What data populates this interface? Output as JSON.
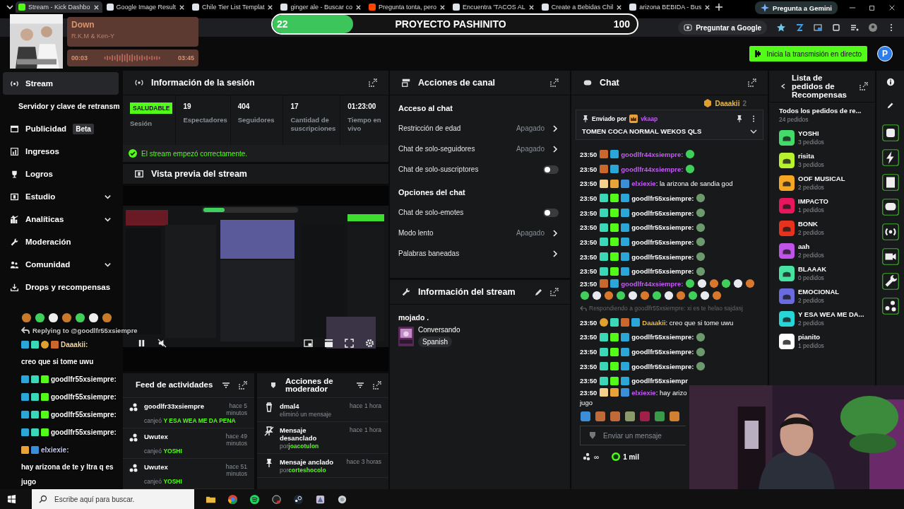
{
  "browser": {
    "tabs": [
      {
        "label": "Stream - Kick Dashbo",
        "selected": true
      },
      {
        "label": "Google Image Result",
        "selected": false
      },
      {
        "label": "Chile Tier List Templat",
        "selected": false
      },
      {
        "label": "ginger ale - Buscar co",
        "selected": false
      },
      {
        "label": "Pregunta tonta, pero",
        "selected": false
      },
      {
        "label": "Encuentra 'TACOS AL",
        "selected": false
      },
      {
        "label": "Create a Bebidas Chil",
        "selected": false
      },
      {
        "label": "arizona BEBIDA - Bus",
        "selected": false
      }
    ],
    "gemini_button": "Pregunta a Gemini",
    "ask_google": "Preguntar a Google"
  },
  "topbar": {
    "go_live": "Inicia la transmisión en directo",
    "avatar": "P"
  },
  "sidebar": {
    "items": [
      {
        "label": "Stream",
        "selected": true,
        "has_submenu": false,
        "children": [
          {
            "label": "Servidor y clave de retransm",
            "selected": false
          }
        ]
      },
      {
        "label": "Publicidad",
        "badge": "Beta",
        "selected": false,
        "has_submenu": false
      },
      {
        "label": "Ingresos",
        "selected": false,
        "has_submenu": false
      },
      {
        "label": "Logros",
        "selected": false,
        "has_submenu": false
      },
      {
        "label": "Estudio",
        "selected": false,
        "has_submenu": true
      },
      {
        "label": "Analíticas",
        "selected": false,
        "has_submenu": true
      },
      {
        "label": "Moderación",
        "selected": false,
        "has_submenu": false
      },
      {
        "label": "Comunidad",
        "selected": false,
        "has_submenu": true
      },
      {
        "label": "Drops y recompensas",
        "selected": false,
        "has_submenu": false
      }
    ]
  },
  "session": {
    "title": "Información de la sesión",
    "status": "SALUDABLE",
    "status_label": "Sesión",
    "stats": [
      {
        "value": "19",
        "label": "Espectadores"
      },
      {
        "value": "404",
        "label": "Seguidores"
      },
      {
        "value": "17",
        "label": "Cantidad de suscripciones"
      },
      {
        "value": "01:23:00",
        "label": "Tiempo en vivo"
      }
    ],
    "message": "El stream empezó correctamente."
  },
  "preview": {
    "title": "Vista previa del stream"
  },
  "activity_feed": {
    "title": "Feed de actividades",
    "items": [
      {
        "user": "goodlfr33xsiempre",
        "action": "canjeó",
        "reward": "Y ESA WEA ME DA PENA",
        "time": "hace 5 minutos"
      },
      {
        "user": "Uwutex",
        "action": "canjeó",
        "reward": "YOSHI",
        "time": "hace 49 minutos"
      },
      {
        "user": "Uwutex",
        "action": "canjeó",
        "reward": "YOSHI",
        "time": "hace 51 minutos"
      }
    ]
  },
  "mod_actions": {
    "title": "Acciones de moderador",
    "items": [
      {
        "kind": "delete",
        "title": "dmal4",
        "detail": "eliminó un mensaje",
        "time": "hace 1 hora"
      },
      {
        "kind": "unpin",
        "title": "Mensaje desanclado",
        "detail_prefix": "por",
        "user": "joacotulon",
        "time": "hace 1 hora"
      },
      {
        "kind": "pin",
        "title": "Mensaje anclado",
        "detail_prefix": "por",
        "user": "corteshocolo",
        "time": "hace 3 horas"
      }
    ]
  },
  "channel_actions": {
    "title": "Acciones de canal",
    "sections": [
      {
        "title": "Acceso al chat",
        "rows": [
          {
            "kind": "link",
            "label": "Restricción de edad",
            "value": "Apagado"
          },
          {
            "kind": "link",
            "label": "Chat de solo-seguidores",
            "value": "Apagado"
          },
          {
            "kind": "toggle",
            "label": "Chat de solo-suscriptores",
            "on": false
          }
        ]
      },
      {
        "title": "Opciones del chat",
        "rows": [
          {
            "kind": "toggle",
            "label": "Chat de solo-emotes",
            "on": false
          },
          {
            "kind": "link",
            "label": "Modo lento",
            "value": "Apagado"
          },
          {
            "kind": "link",
            "label": "Palabras baneadas"
          }
        ]
      }
    ]
  },
  "stream_info": {
    "title": "Información del stream",
    "stream_title": "mojado .",
    "category": "Conversando",
    "tag": "Spanish"
  },
  "chat": {
    "title": "Chat",
    "leader": {
      "name": "Daaakii",
      "count": "2"
    },
    "pinned": {
      "label": "Enviado por",
      "user": "vkaap",
      "text": "TOMEN COCA NORMAL WEKOS QLS"
    },
    "messages": [
      {
        "kind": "message",
        "time": "23:50",
        "badges": [
          {
            "kind": "p"
          },
          {
            "kind": "mod"
          }
        ],
        "user": "goodlfr44xsiempre:",
        "color": "#c15cf2",
        "emotes": [
          {
            "kind": "frog"
          }
        ]
      },
      {
        "kind": "message",
        "time": "23:50",
        "badges": [
          {
            "kind": "p"
          },
          {
            "kind": "mod"
          }
        ],
        "user": "goodlfr44xsiempre:",
        "color": "#c15cf2",
        "emotes": [
          {
            "kind": "frog"
          }
        ]
      },
      {
        "kind": "message",
        "time": "23:50",
        "badges": [
          {
            "kind": "age"
          },
          {
            "kind": "crown"
          },
          {
            "kind": "pblue"
          }
        ],
        "user": "elxiexie",
        "color": "#c15cf2",
        "text": ": la arizona de sandia god"
      },
      {
        "kind": "message",
        "time": "23:50",
        "badges": [
          {
            "kind": "sub"
          },
          {
            "kind": "gift"
          },
          {
            "kind": "mod"
          }
        ],
        "user": "goodlfr55xsiempre:",
        "color": "#ffffff",
        "emotes": [
          {
            "kind": "pepe"
          }
        ]
      },
      {
        "kind": "message",
        "time": "23:50",
        "badges": [
          {
            "kind": "sub"
          },
          {
            "kind": "gift"
          },
          {
            "kind": "mod"
          }
        ],
        "user": "goodlfr55xsiempre:",
        "color": "#ffffff",
        "emotes": [
          {
            "kind": "pepe"
          }
        ]
      },
      {
        "kind": "message",
        "time": "23:50",
        "badges": [
          {
            "kind": "sub"
          },
          {
            "kind": "gift"
          },
          {
            "kind": "mod"
          }
        ],
        "user": "goodlfr55xsiempre:",
        "color": "#ffffff",
        "emotes": [
          {
            "kind": "pepe"
          }
        ]
      },
      {
        "kind": "message",
        "time": "23:50",
        "badges": [
          {
            "kind": "sub"
          },
          {
            "kind": "gift"
          },
          {
            "kind": "mod"
          }
        ],
        "user": "goodlfr55xsiempre:",
        "color": "#ffffff",
        "emotes": [
          {
            "kind": "pepe"
          }
        ]
      },
      {
        "kind": "message",
        "time": "23:50",
        "badges": [
          {
            "kind": "sub"
          },
          {
            "kind": "gift"
          },
          {
            "kind": "mod"
          }
        ],
        "user": "goodlfr55xsiempre:",
        "color": "#ffffff",
        "emotes": [
          {
            "kind": "pepe"
          }
        ]
      },
      {
        "kind": "message",
        "time": "23:50",
        "badges": [
          {
            "kind": "sub"
          },
          {
            "kind": "gift"
          },
          {
            "kind": "mod"
          }
        ],
        "user": "goodlfr55xsiempre:",
        "color": "#ffffff",
        "emotes": [
          {
            "kind": "pepe"
          }
        ]
      },
      {
        "kind": "message",
        "time": "23:50",
        "badges": [
          {
            "kind": "p"
          },
          {
            "kind": "mod"
          }
        ],
        "user": "goodlfr44xsiempre:",
        "color": "#c15cf2",
        "emotes": [
          {
            "kind": "frog"
          },
          {
            "kind": "cup"
          },
          {
            "kind": "cat"
          },
          {
            "kind": "frog"
          },
          {
            "kind": "cup"
          },
          {
            "kind": "cat"
          },
          {
            "kind": "frog"
          },
          {
            "kind": "cup"
          },
          {
            "kind": "cat"
          },
          {
            "kind": "frog"
          },
          {
            "kind": "cup"
          },
          {
            "kind": "cat"
          },
          {
            "kind": "frog"
          },
          {
            "kind": "cup"
          },
          {
            "kind": "cat"
          },
          {
            "kind": "frog"
          },
          {
            "kind": "cup"
          },
          {
            "kind": "cat"
          }
        ]
      },
      {
        "kind": "reply",
        "text": "Respondiendo a goodlfr55xsiempre: xi es te helao sajdasj"
      },
      {
        "kind": "message",
        "time": "23:50",
        "badges": [
          {
            "kind": "coin"
          },
          {
            "kind": "sub"
          },
          {
            "kind": "p"
          },
          {
            "kind": "mod"
          }
        ],
        "user": "Daaakii",
        "color": "#e8b94a",
        "text": ": creo que si tome uwu"
      },
      {
        "kind": "message",
        "time": "23:50",
        "badges": [
          {
            "kind": "sub"
          },
          {
            "kind": "gift"
          },
          {
            "kind": "mod"
          }
        ],
        "user": "goodlfr55xsiempre:",
        "color": "#ffffff",
        "emotes": [
          {
            "kind": "pepe"
          }
        ]
      },
      {
        "kind": "message",
        "time": "23:50",
        "badges": [
          {
            "kind": "sub"
          },
          {
            "kind": "gift"
          },
          {
            "kind": "mod"
          }
        ],
        "user": "goodlfr55xsiempre:",
        "color": "#ffffff",
        "emotes": [
          {
            "kind": "pepe"
          }
        ]
      },
      {
        "kind": "message",
        "time": "23:50",
        "badges": [
          {
            "kind": "sub"
          },
          {
            "kind": "gift"
          },
          {
            "kind": "mod"
          }
        ],
        "user": "goodlfr55xsiempre:",
        "color": "#ffffff",
        "emotes": [
          {
            "kind": "pepe"
          }
        ]
      },
      {
        "kind": "message",
        "time": "23:50",
        "badges": [
          {
            "kind": "sub"
          },
          {
            "kind": "gift"
          },
          {
            "kind": "mod"
          }
        ],
        "user": "goodlfr55xsiempr",
        "color": "#ffffff"
      },
      {
        "kind": "message",
        "time": "23:50",
        "badges": [
          {
            "kind": "age"
          },
          {
            "kind": "crown"
          },
          {
            "kind": "pblue"
          }
        ],
        "user": "elxiexie",
        "color": "#c15cf2",
        "text": ": hay arizo",
        "continuation": "jugo"
      }
    ],
    "input": {
      "placeholder": "Enviar un mensaje"
    },
    "footer": {
      "infinity": "∞",
      "points": "1 mil"
    }
  },
  "rewards": {
    "title": "Lista de pedidos de Recompensas",
    "all": {
      "label": "Todos los pedidos de re...",
      "count": "24 pedidos"
    },
    "items": [
      {
        "name": "YOSHI",
        "count": "3 pedidos",
        "color": "#44d96b"
      },
      {
        "name": "risita",
        "count": "3 pedidos",
        "color": "#b8f22f"
      },
      {
        "name": "OOF MUSICAL",
        "count": "2 pedidos",
        "color": "#f5a623"
      },
      {
        "name": "IMPACTO",
        "count": "1 pedidos",
        "color": "#e8175d"
      },
      {
        "name": "BONK",
        "count": "2 pedidos",
        "color": "#e8321e"
      },
      {
        "name": "aah",
        "count": "2 pedidos",
        "color": "#c054e8"
      },
      {
        "name": "BLAAAK",
        "count": "0 pedidos",
        "color": "#46e3a3"
      },
      {
        "name": "EMOCIONAL",
        "count": "2 pedidos",
        "color": "#6b6be0"
      },
      {
        "name": "Y ESA WEA ME DA...",
        "count": "2 pedidos",
        "color": "#27d6d6"
      },
      {
        "name": "pianito",
        "count": "1 pedidos",
        "color": "#ffffff"
      }
    ]
  },
  "taskbar": {
    "search_placeholder": "Escribe aquí para buscar."
  },
  "overlay_music": {
    "title": "Down",
    "artist": "R.K.M & Ken-Y",
    "elapsed": "00:03",
    "duration": "03:45"
  },
  "overlay_goal": {
    "current": "22",
    "title": "PROYECTO PASHINITO",
    "target": "100",
    "level": 0.22
  },
  "overlay_chat": {
    "reply": "Replying to @goodlfr55xsiempre",
    "lines": [
      {
        "badges": [
          {
            "kind": "mod"
          },
          {
            "kind": "sub"
          },
          {
            "kind": "coin"
          },
          {
            "kind": "p"
          }
        ],
        "user": "Daaakii:",
        "color": "#f0d9a0",
        "text": "creo que si tome uwu"
      },
      {
        "badges": [
          {
            "kind": "mod"
          },
          {
            "kind": "sub"
          },
          {
            "kind": "gift"
          }
        ],
        "user": "goodlfr55xsiempre:",
        "color": "#ffffff"
      },
      {
        "badges": [
          {
            "kind": "mod"
          },
          {
            "kind": "sub"
          },
          {
            "kind": "gift"
          }
        ],
        "user": "goodlfr55xsiempre:",
        "color": "#ffffff"
      },
      {
        "badges": [
          {
            "kind": "mod"
          },
          {
            "kind": "sub"
          },
          {
            "kind": "gift"
          }
        ],
        "user": "goodlfr55xsiempre:",
        "color": "#ffffff"
      },
      {
        "badges": [
          {
            "kind": "mod"
          },
          {
            "kind": "sub"
          },
          {
            "kind": "gift"
          }
        ],
        "user": "goodlfr55xsiempre:",
        "color": "#ffffff"
      },
      {
        "badges": [
          {
            "kind": "crown"
          },
          {
            "kind": "pblue"
          }
        ],
        "user": "elxiexie:",
        "color": "#c6c6ea",
        "text": "hay arizona de te y ltra q es jugo"
      }
    ]
  }
}
